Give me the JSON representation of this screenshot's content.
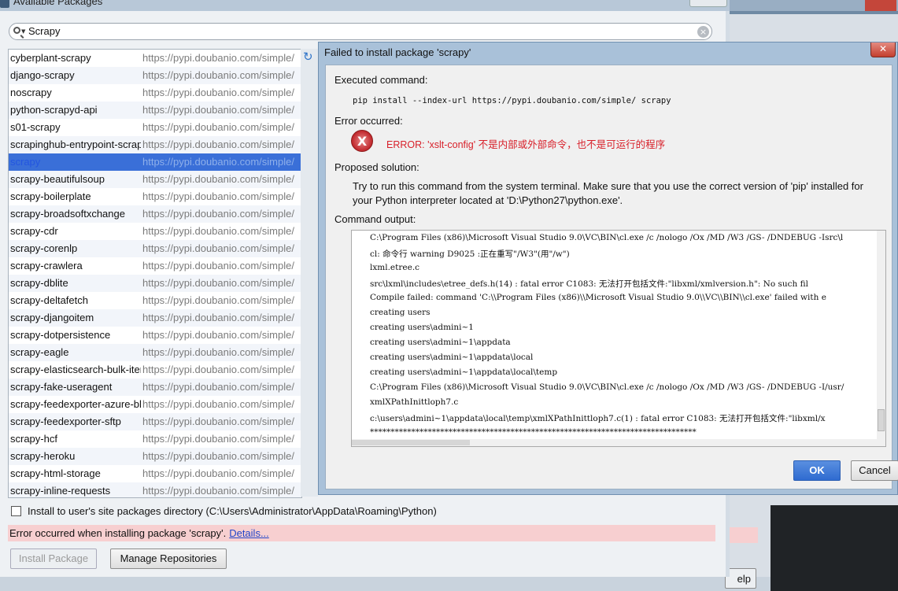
{
  "main_window": {
    "title": "Available Packages",
    "search": {
      "value": "Scrapy"
    },
    "packages": [
      {
        "name": "cyberplant-scrapy",
        "url": "https://pypi.doubanio.com/simple/"
      },
      {
        "name": "django-scrapy",
        "url": "https://pypi.doubanio.com/simple/"
      },
      {
        "name": "noscrapy",
        "url": "https://pypi.doubanio.com/simple/"
      },
      {
        "name": "python-scrapyd-api",
        "url": "https://pypi.doubanio.com/simple/"
      },
      {
        "name": "s01-scrapy",
        "url": "https://pypi.doubanio.com/simple/"
      },
      {
        "name": "scrapinghub-entrypoint-scrapy",
        "url": "https://pypi.doubanio.com/simple/"
      },
      {
        "name": "scrapy",
        "url": "https://pypi.doubanio.com/simple/"
      },
      {
        "name": "scrapy-beautifulsoup",
        "url": "https://pypi.doubanio.com/simple/"
      },
      {
        "name": "scrapy-boilerplate",
        "url": "https://pypi.doubanio.com/simple/"
      },
      {
        "name": "scrapy-broadsoftxchange",
        "url": "https://pypi.doubanio.com/simple/"
      },
      {
        "name": "scrapy-cdr",
        "url": "https://pypi.doubanio.com/simple/"
      },
      {
        "name": "scrapy-corenlp",
        "url": "https://pypi.doubanio.com/simple/"
      },
      {
        "name": "scrapy-crawlera",
        "url": "https://pypi.doubanio.com/simple/"
      },
      {
        "name": "scrapy-dblite",
        "url": "https://pypi.doubanio.com/simple/"
      },
      {
        "name": "scrapy-deltafetch",
        "url": "https://pypi.doubanio.com/simple/"
      },
      {
        "name": "scrapy-djangoitem",
        "url": "https://pypi.doubanio.com/simple/"
      },
      {
        "name": "scrapy-dotpersistence",
        "url": "https://pypi.doubanio.com/simple/"
      },
      {
        "name": "scrapy-eagle",
        "url": "https://pypi.doubanio.com/simple/"
      },
      {
        "name": "scrapy-elasticsearch-bulk-item-exporter",
        "url": "https://pypi.doubanio.com/simple/"
      },
      {
        "name": "scrapy-fake-useragent",
        "url": "https://pypi.doubanio.com/simple/"
      },
      {
        "name": "scrapy-feedexporter-azure-blob",
        "url": "https://pypi.doubanio.com/simple/"
      },
      {
        "name": "scrapy-feedexporter-sftp",
        "url": "https://pypi.doubanio.com/simple/"
      },
      {
        "name": "scrapy-hcf",
        "url": "https://pypi.doubanio.com/simple/"
      },
      {
        "name": "scrapy-heroku",
        "url": "https://pypi.doubanio.com/simple/"
      },
      {
        "name": "scrapy-html-storage",
        "url": "https://pypi.doubanio.com/simple/"
      },
      {
        "name": "scrapy-inline-requests",
        "url": "https://pypi.doubanio.com/simple/"
      }
    ],
    "selected_package": "scrapy",
    "install_to_user_label": "Install to user's site packages directory (C:\\Users\\Administrator\\AppData\\Roaming\\Python)",
    "install_to_user_checked": false,
    "error_message": "Error occurred when installing package 'scrapy'.",
    "details_link": "Details...",
    "install_button": "Install Package",
    "manage_button": "Manage Repositories"
  },
  "background_window": {
    "help_button": "elp"
  },
  "dialog": {
    "title": "Failed to install package 'scrapy'",
    "executed_command_label": "Executed command:",
    "executed_command": "pip install --index-url https://pypi.doubanio.com/simple/ scrapy",
    "error_label": "Error occurred:",
    "error_text": "ERROR: 'xslt-config' 不是内部或外部命令，也不是可运行的程序",
    "solution_label": "Proposed solution:",
    "solution_line1": "Try to run this command from the system terminal. Make sure that you use the correct version of 'pip' installed for",
    "solution_line2": "your Python interpreter located at 'D:\\Python27\\python.exe'.",
    "output_label": "Command output:",
    "output_lines": [
      "C:\\Program Files (x86)\\Microsoft Visual Studio 9.0\\VC\\BIN\\cl.exe /c /nologo /Ox /MD /W3 /GS- /DNDEBUG -Isrc\\l",
      "cl: 命令行 warning D9025 :正在重写\"/W3\"(用\"/w\")",
      "lxml.etree.c",
      "src\\lxml\\includes\\etree_defs.h(14) : fatal error C1083: 无法打开包括文件:\"libxml/xmlversion.h\": No such fil",
      "Compile failed: command 'C:\\\\Program Files (x86)\\\\Microsoft Visual Studio 9.0\\\\VC\\\\BIN\\\\cl.exe' failed with e",
      "creating users",
      "creating users\\admini~1",
      "creating users\\admini~1\\appdata",
      "creating users\\admini~1\\appdata\\local",
      "creating users\\admini~1\\appdata\\local\\temp",
      "C:\\Program Files (x86)\\Microsoft Visual Studio 9.0\\VC\\BIN\\cl.exe /c /nologo /Ox /MD /W3 /GS- /DNDEBUG -I/usr/",
      "xmlXPathInittloph7.c",
      "c:\\users\\admini~1\\appdata\\local\\temp\\xmlXPathInittloph7.c(1) : fatal error C1083: 无法打开包括文件:\"libxml/x",
      "*******************************************************************************"
    ],
    "ok_button": "OK",
    "cancel_button": "Cancel"
  },
  "colors": {
    "selection": "#3a6fd8",
    "error_text": "#d8202a",
    "error_bar": "#f7cfd0",
    "ok_button": "#2f6bd0"
  }
}
